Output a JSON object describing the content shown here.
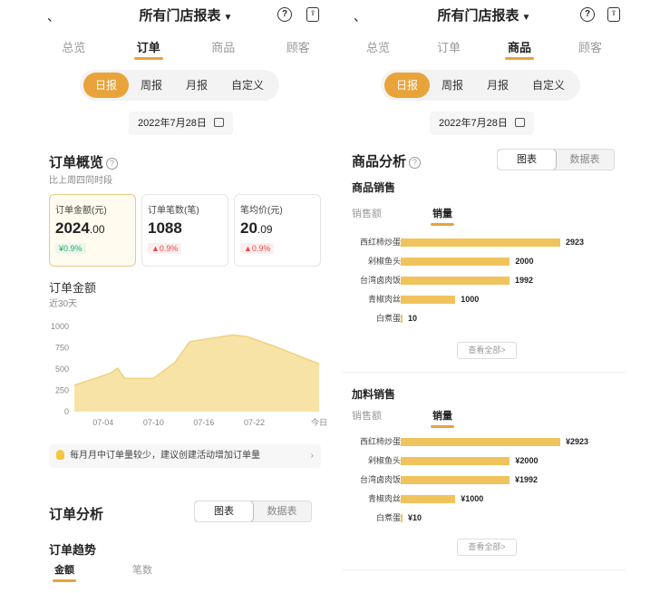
{
  "left": {
    "header": {
      "back": "、",
      "title": "所有门店报表",
      "caret": "▼",
      "help": "?",
      "share": "⇪"
    },
    "tabs": [
      "总览",
      "订单",
      "商品",
      "顾客"
    ],
    "active_tab": 1,
    "periods": [
      "日报",
      "周报",
      "月报",
      "自定义"
    ],
    "date": "2022年7月28日",
    "overview": {
      "title": "订单概览",
      "subtitle": "比上周四同时段",
      "cards": [
        {
          "label": "订单金额(元)",
          "value_main": "2024",
          "value_dec": ".00",
          "badge": "¥0.9%",
          "trend": "down"
        },
        {
          "label": "订单笔数(笔)",
          "value_main": "1088",
          "value_dec": "",
          "badge": "▲0.9%",
          "trend": "up"
        },
        {
          "label": "笔均价(元)",
          "value_main": "20",
          "value_dec": ".09",
          "badge": "▲0.9%",
          "trend": "up"
        }
      ]
    },
    "amount": {
      "title": "订单金额",
      "subtitle": "近30天"
    },
    "tip": {
      "text": "每月月中订单量较少，建议创建活动增加订单量",
      "arrow": "›"
    },
    "analysis": {
      "title": "订单分析",
      "toggle": [
        "图表",
        "数据表"
      ],
      "trend_title": "订单趋势",
      "subtabs": [
        "金额",
        "笔数"
      ]
    }
  },
  "chart_data": {
    "type": "area",
    "title": "订单金额",
    "subtitle": "近30天",
    "x_ticks": [
      "07-04",
      "07-10",
      "07-16",
      "07-22",
      "今日"
    ],
    "y_ticks": [
      0,
      250,
      500,
      750,
      1000
    ],
    "ylim": [
      0,
      1000
    ],
    "x_index": [
      0,
      5,
      6,
      7,
      11,
      14,
      16,
      22,
      24,
      28,
      34
    ],
    "values": [
      310,
      450,
      510,
      390,
      390,
      580,
      820,
      900,
      880,
      760,
      560
    ],
    "color": "#f7e3a6",
    "line_color": "#efd27e"
  },
  "right": {
    "header": {
      "back": "、",
      "title": "所有门店报表",
      "caret": "▼",
      "help": "?",
      "share": "⇪"
    },
    "tabs": [
      "总览",
      "订单",
      "商品",
      "顾客"
    ],
    "active_tab": 2,
    "periods": [
      "日报",
      "周报",
      "月报",
      "自定义"
    ],
    "date": "2022年7月28日",
    "analysis_title": "商品分析",
    "toggle": [
      "图表",
      "数据表"
    ],
    "sales": {
      "title": "商品销售",
      "subtabs": [
        "销售额",
        "销量"
      ],
      "items": [
        {
          "name": "西红柿炒蛋",
          "value": 2923,
          "label": "2923"
        },
        {
          "name": "剁椒鱼头",
          "value": 2000,
          "label": "2000"
        },
        {
          "name": "台湾卤肉饭",
          "value": 1992,
          "label": "1992"
        },
        {
          "name": "青椒肉丝",
          "value": 1000,
          "label": "1000"
        },
        {
          "name": "白煮蛋",
          "value": 10,
          "label": "10"
        }
      ],
      "view_all": "查看全部>"
    },
    "addon": {
      "title": "加料销售",
      "subtabs": [
        "销售额",
        "销量"
      ],
      "items": [
        {
          "name": "西红柿炒蛋",
          "value": 2923,
          "label": "¥2923"
        },
        {
          "name": "剁椒鱼头",
          "value": 2000,
          "label": "¥2000"
        },
        {
          "name": "台湾卤肉饭",
          "value": 1992,
          "label": "¥1992"
        },
        {
          "name": "青椒肉丝",
          "value": 1000,
          "label": "¥1000"
        },
        {
          "name": "白煮蛋",
          "value": 10,
          "label": "¥10"
        }
      ],
      "view_all": "查看全部>"
    }
  },
  "colors": {
    "accent": "#e8a33b",
    "bar": "#f0c35c",
    "down": "#2bab62",
    "up": "#e8494a"
  }
}
